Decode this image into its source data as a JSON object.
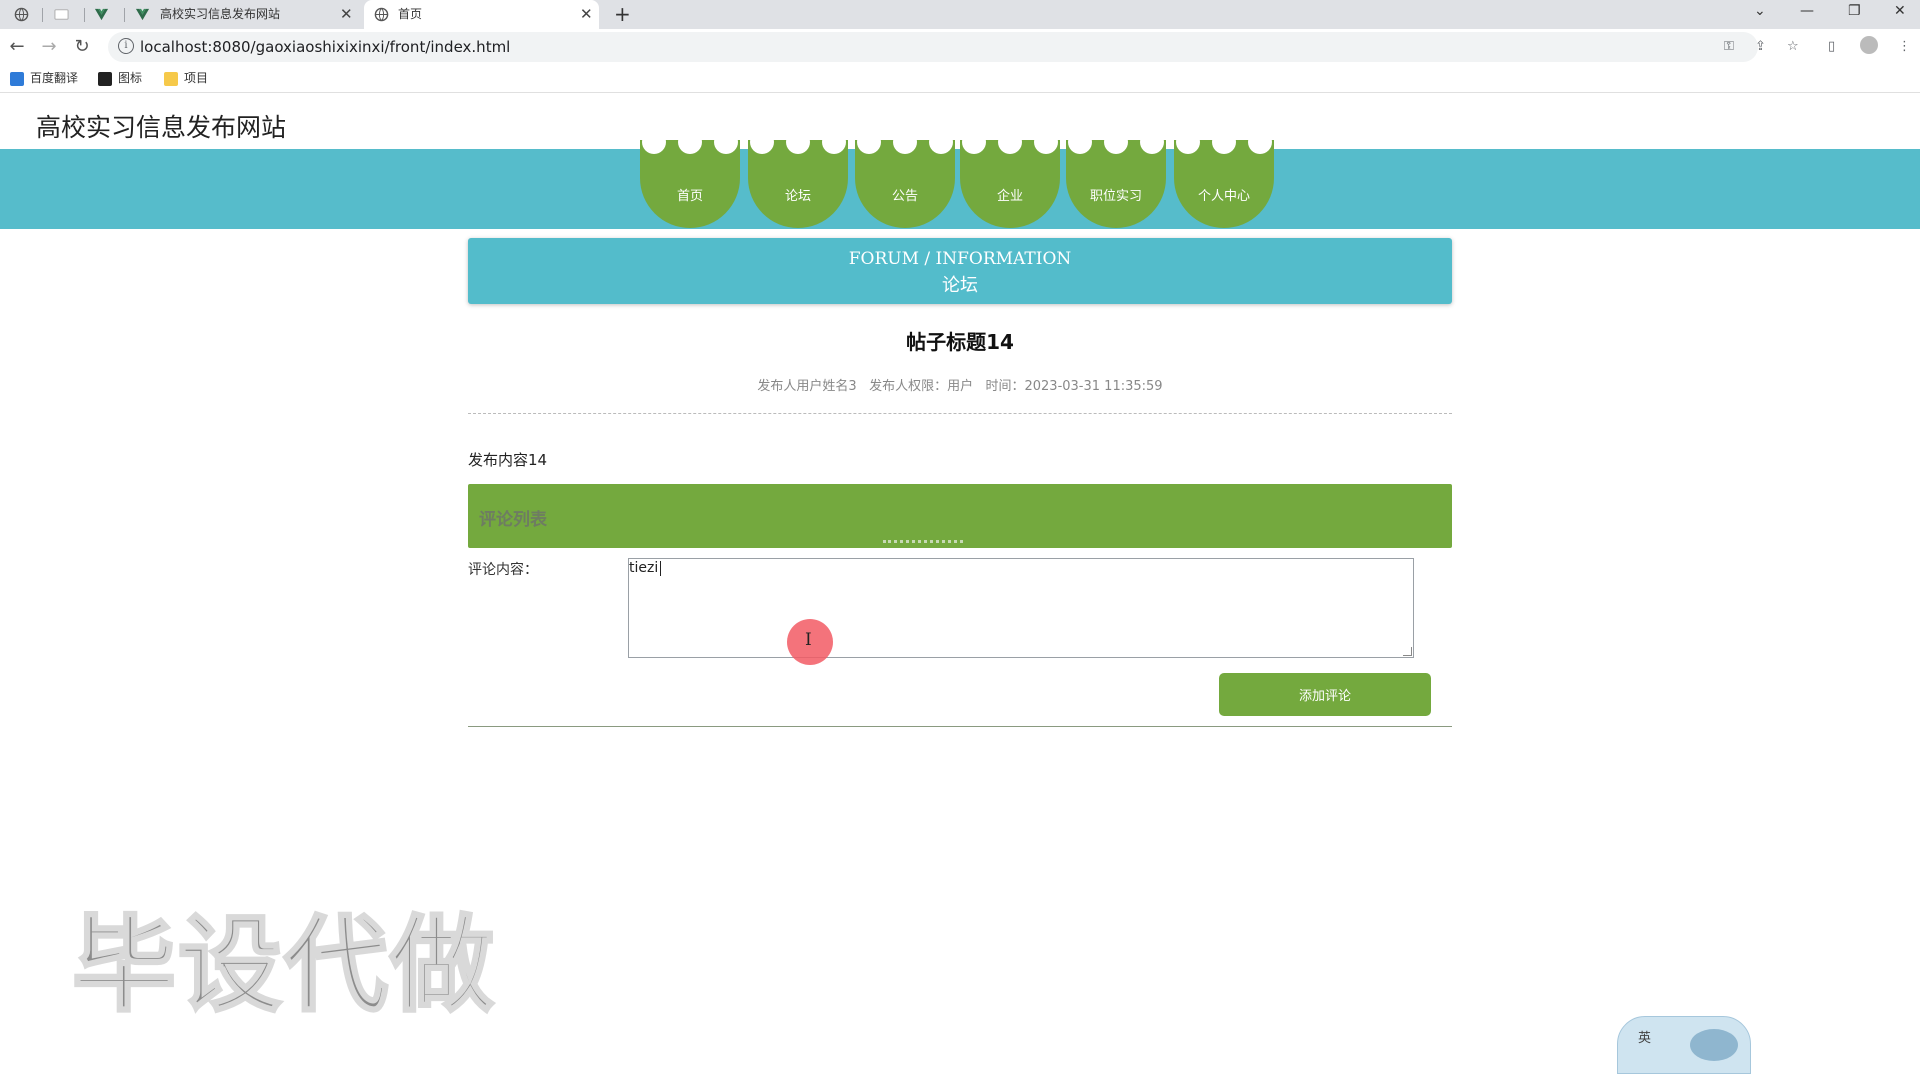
{
  "browser": {
    "tabs": [
      {
        "label": "",
        "icon": "globe-icon"
      },
      {
        "label": "",
        "icon": "blank-page-icon"
      },
      {
        "label": "",
        "icon": "vue-icon"
      },
      {
        "label": "高校实习信息发布网站",
        "icon": "vue-icon"
      },
      {
        "label": "首页",
        "icon": "globe-icon",
        "active": true
      }
    ],
    "url": "localhost:8080/gaoxiaoshixixinxi/front/index.html",
    "bookmarks": [
      {
        "label": "百度翻译",
        "icon": "translate-icon",
        "color": "#2f7bd8"
      },
      {
        "label": "图标",
        "icon": "image-icon",
        "color": "#222222"
      },
      {
        "label": "项目",
        "icon": "folder-icon",
        "color": "#f6c94a"
      }
    ]
  },
  "site": {
    "title": "高校实习信息发布网站",
    "nav": [
      "首页",
      "论坛",
      "公告",
      "企业",
      "职位实习",
      "个人中心"
    ]
  },
  "banner": {
    "en": "FORUM / INFORMATION",
    "cn": "论坛"
  },
  "post": {
    "title": "帖子标题14",
    "meta": "发布人用户姓名3   发布人权限：用户   时间：2023-03-31 11:35:59",
    "content": "发布内容14"
  },
  "comments": {
    "header": "评论列表",
    "field_label": "评论内容：",
    "field_value": "tiezi",
    "submit_label": "添加评论"
  },
  "overlay": {
    "watermark": "毕设代做",
    "ime_label": "英"
  },
  "colors": {
    "nav_band": "#56bccb",
    "accent_green": "#74a93e",
    "banner": "#53bccb"
  }
}
